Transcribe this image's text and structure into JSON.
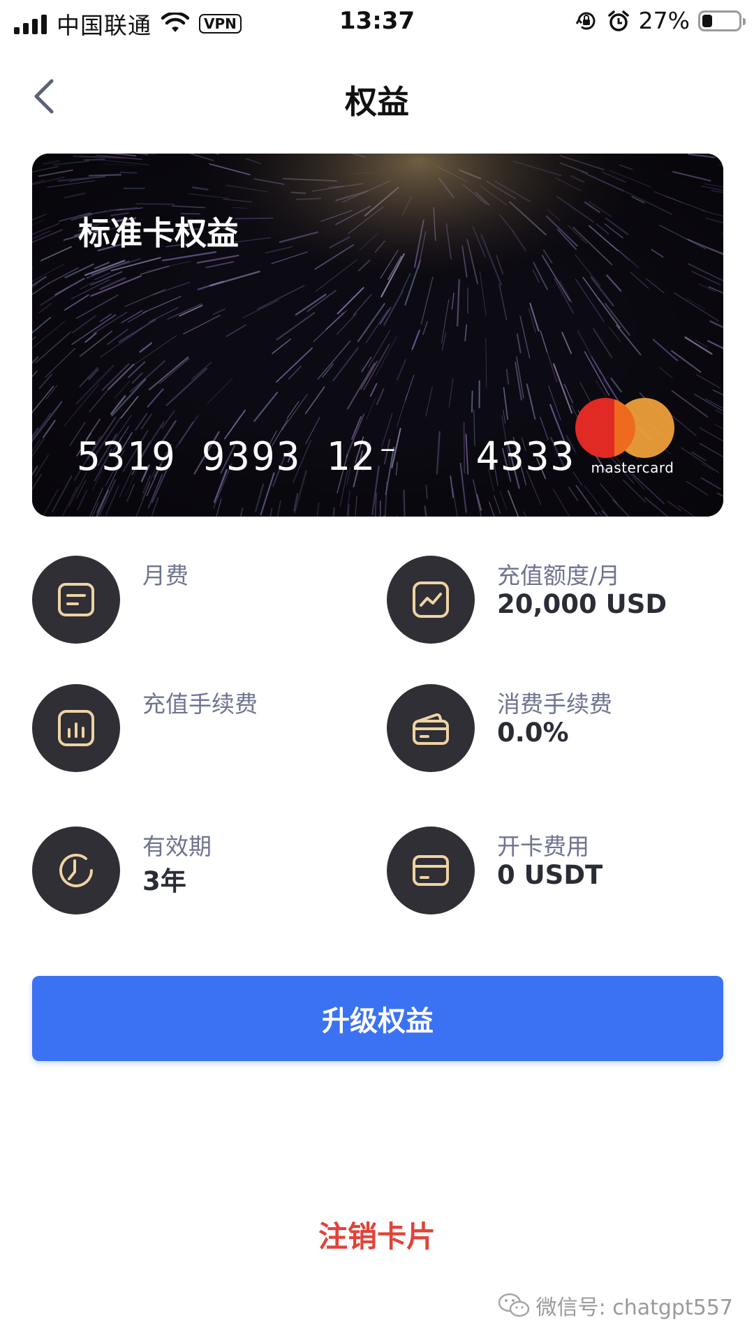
{
  "status_bar": {
    "carrier": "中国联通",
    "vpn": "VPN",
    "time": "13:37",
    "battery": "27%",
    "battery_level": 0.27
  },
  "nav": {
    "title": "权益",
    "back_icon": "chevron-left-icon"
  },
  "card": {
    "title": "标准卡权益",
    "number": "5319 9393 12⁻   4333",
    "brand": "mastercard",
    "brand_colors": [
      "#e12a24",
      "#f2a23a"
    ]
  },
  "benefits": [
    {
      "label": "月费",
      "value": "",
      "icon": "document-icon"
    },
    {
      "label": "充值额度/月",
      "value": "20,000 USD",
      "icon": "trend-chart-icon"
    },
    {
      "label": "充值手续费",
      "value": "",
      "icon": "bar-chart-icon"
    },
    {
      "label": "消费手续费",
      "value": "0.0%",
      "icon": "wallet-card-icon"
    },
    {
      "label": "有效期",
      "value": "3年",
      "icon": "clock-icon"
    },
    {
      "label": "开卡费用",
      "value": "0 USDT",
      "icon": "credit-card-icon"
    }
  ],
  "actions": {
    "upgrade": "升级权益",
    "cancel": "注销卡片"
  },
  "watermark": {
    "text": "微信号: chatgpt557"
  },
  "colors": {
    "primary": "#3b72f3",
    "danger": "#e0443a",
    "icon_bg": "#2f2f35",
    "icon_stroke": "#f0d3a3"
  }
}
